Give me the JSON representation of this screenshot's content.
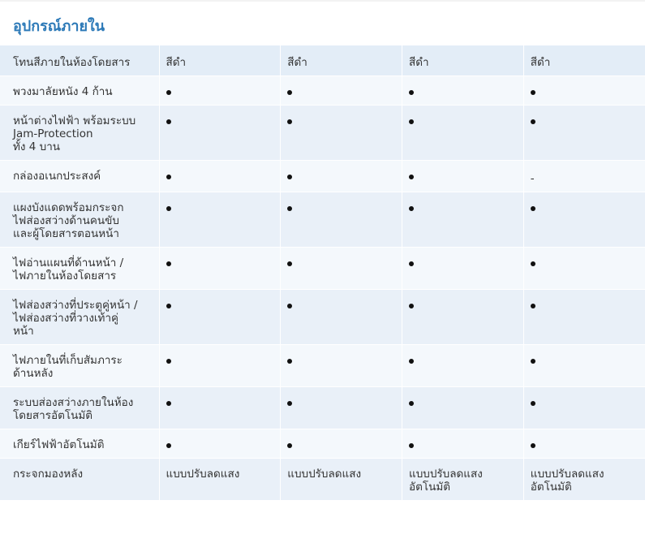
{
  "title": "อุปกรณ์ภายใน",
  "table": {
    "header": {
      "label": "โทนสีภายในห้องโดยสาร",
      "values": [
        "สีดำ",
        "สีดำ",
        "สีดำ",
        "สีดำ"
      ]
    },
    "rows": [
      {
        "label": "พวงมาลัยหนัง 4 ก้าน",
        "values": [
          "dot",
          "dot",
          "dot",
          "dot"
        ]
      },
      {
        "label": "หน้าต่างไฟฟ้า พร้อมระบบ\nJam-Protection\nทั้ง 4 บาน",
        "values": [
          "dot",
          "dot",
          "dot",
          "dot"
        ]
      },
      {
        "label": "กล่องอเนกประสงค์",
        "values": [
          "dot",
          "dot",
          "dot",
          "-"
        ]
      },
      {
        "label": "แผงบังแดดพร้อมกระจก\nไฟส่องสว่างด้านคนขับ\nและผู้โดยสารตอนหน้า",
        "values": [
          "dot",
          "dot",
          "dot",
          "dot"
        ]
      },
      {
        "label": "ไฟอ่านแผนที่ด้านหน้า /\nไฟภายในห้องโดยสาร",
        "values": [
          "dot",
          "dot",
          "dot",
          "dot"
        ]
      },
      {
        "label": "ไฟส่องสว่างที่ประตูคู่หน้า /\nไฟส่องสว่างที่วางเท้าคู่\nหน้า",
        "values": [
          "dot",
          "dot",
          "dot",
          "dot"
        ]
      },
      {
        "label": "ไฟภายในที่เก็บสัมภาระ\nด้านหลัง",
        "values": [
          "dot",
          "dot",
          "dot",
          "dot"
        ]
      },
      {
        "label": "ระบบส่องสว่างภายในห้อง\nโดยสารอัตโนมัติ",
        "values": [
          "dot",
          "dot",
          "dot",
          "dot"
        ]
      },
      {
        "label": "เกียร์ไฟฟ้าอัตโนมัติ",
        "values": [
          "dot",
          "dot",
          "dot",
          "dot"
        ]
      },
      {
        "label": "กระจกมองหลัง",
        "values": [
          "แบบปรับลดแสง",
          "แบบปรับลดแสง",
          "แบบปรับลดแสง\nอัตโนมัติ",
          "แบบปรับลดแสง\nอัตโนมัติ"
        ]
      }
    ]
  },
  "colors": {
    "title": "#2d7ab8",
    "header_row_bg": "#e3edf7",
    "row_bg_light": "#f4f8fc",
    "row_bg_dark": "#e9f0f8"
  },
  "icons": {
    "available": "bullet-dot-icon",
    "not_available": "dash"
  }
}
